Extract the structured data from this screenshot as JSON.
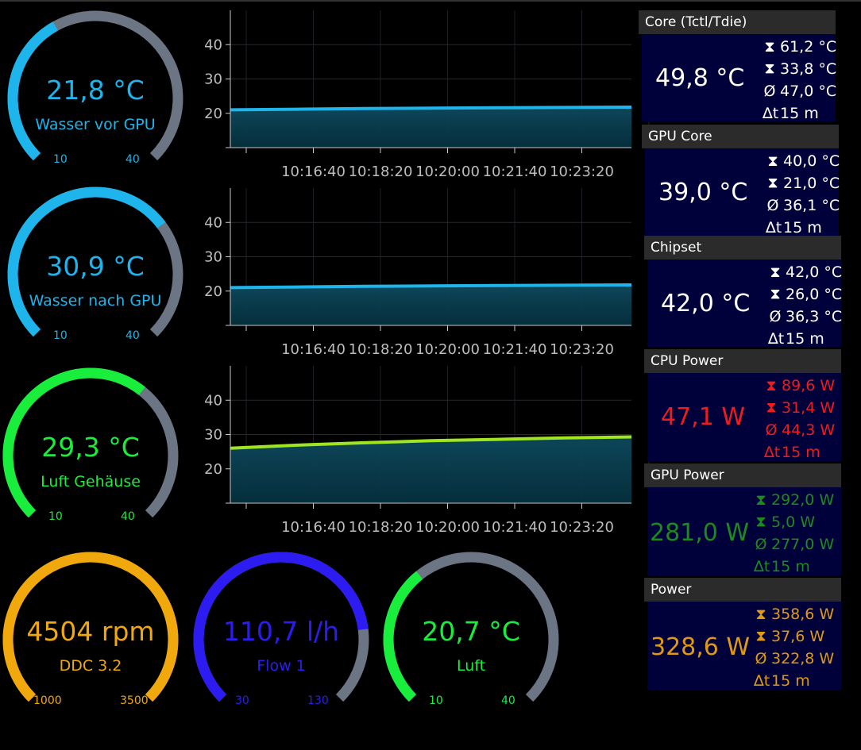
{
  "gauges": [
    {
      "id": "wasser-vor-gpu",
      "value": "21,8 °C",
      "label": "Wasser vor GPU",
      "min": "10",
      "max": "40",
      "fraction": 0.393,
      "color": "#1eb4ec"
    },
    {
      "id": "wasser-nach-gpu",
      "value": "30,9 °C",
      "label": "Wasser nach GPU",
      "min": "10",
      "max": "40",
      "fraction": 0.697,
      "color": "#1eb4ec"
    },
    {
      "id": "luft-gehaeuse",
      "value": "29,3 °C",
      "label": "Luft Gehäuse",
      "min": "10",
      "max": "40",
      "fraction": 0.643,
      "color": "#1aee3c"
    },
    {
      "id": "ddc",
      "value": "4504 rpm",
      "label": "DDC 3.2",
      "min": "1000",
      "max": "3500",
      "fraction": 1.0,
      "color": "#f0a80c"
    },
    {
      "id": "flow",
      "value": "110,7 l/h",
      "label": "Flow 1",
      "min": "30",
      "max": "130",
      "fraction": 0.807,
      "color": "#2d1cf2"
    },
    {
      "id": "luft",
      "value": "20,7 °C",
      "label": "Luft",
      "min": "10",
      "max": "40",
      "fraction": 0.357,
      "color": "#1aee3c"
    }
  ],
  "chart_data": [
    {
      "type": "area",
      "series": [
        {
          "name": "Wasser vor GPU",
          "values": [
            21.0,
            21.2,
            21.4,
            21.5,
            21.6,
            21.7,
            21.8
          ]
        }
      ],
      "x": [
        "10:15:00",
        "10:16:40",
        "10:18:20",
        "10:20:00",
        "10:21:40",
        "10:23:20",
        "10:25:00"
      ],
      "x_tick_labels": [
        "10:16:40",
        "10:18:20",
        "10:20:00",
        "10:21:40",
        "10:23:20"
      ],
      "y_tick_labels": [
        "20",
        "30",
        "40"
      ],
      "ylim": [
        10,
        50
      ],
      "color": "#1eb4ec",
      "grid": true
    },
    {
      "type": "area",
      "series": [
        {
          "name": "Wasser nach GPU",
          "values": [
            21.0,
            21.2,
            21.4,
            21.5,
            21.6,
            21.7,
            21.8
          ]
        }
      ],
      "x": [
        "10:15:00",
        "10:16:40",
        "10:18:20",
        "10:20:00",
        "10:21:40",
        "10:23:20",
        "10:25:00"
      ],
      "x_tick_labels": [
        "10:16:40",
        "10:18:20",
        "10:20:00",
        "10:21:40",
        "10:23:20"
      ],
      "y_tick_labels": [
        "20",
        "30",
        "40"
      ],
      "ylim": [
        10,
        50
      ],
      "color": "#1eb4ec",
      "grid": true
    },
    {
      "type": "area",
      "series": [
        {
          "name": "Luft Gehäuse",
          "values": [
            26.0,
            26.9,
            27.6,
            28.2,
            28.6,
            29.0,
            29.3
          ]
        }
      ],
      "x": [
        "10:15:00",
        "10:16:40",
        "10:18:20",
        "10:20:00",
        "10:21:40",
        "10:23:20",
        "10:25:00"
      ],
      "x_tick_labels": [
        "10:16:40",
        "10:18:20",
        "10:20:00",
        "10:21:40",
        "10:23:20"
      ],
      "y_tick_labels": [
        "20",
        "30",
        "40"
      ],
      "ylim": [
        10,
        50
      ],
      "color": "#9fe620",
      "grid": true
    }
  ],
  "panels": [
    {
      "title": "Core (Tctl/Tdie)",
      "value": "49,8 °C",
      "max": "61,2 °C",
      "min": "33,8 °C",
      "avg": "47,0 °C",
      "dt": "15 m",
      "color": "#ffffff"
    },
    {
      "title": "GPU Core",
      "value": "39,0 °C",
      "max": "40,0 °C",
      "min": "21,0 °C",
      "avg": "36,1 °C",
      "dt": "15 m",
      "color": "#ffffff"
    },
    {
      "title": "Chipset",
      "value": "42,0 °C",
      "max": "42,0 °C",
      "min": "26,0 °C",
      "avg": "36,3 °C",
      "dt": "15 m",
      "color": "#ffffff"
    },
    {
      "title": "CPU Power",
      "value": "47,1 W",
      "max": "89,6 W",
      "min": "31,4 W",
      "avg": "44,3 W",
      "dt": "15 m",
      "color": "#ee1c1c"
    },
    {
      "title": "GPU Power",
      "value": "281,0 W",
      "max": "292,0 W",
      "min": "5,0 W",
      "avg": "277,0 W",
      "dt": "15 m",
      "color": "#1d8a1d"
    },
    {
      "title": "Power",
      "value": "328,6 W",
      "max": "358,6 W",
      "min": "37,6 W",
      "avg": "322,8 W",
      "dt": "15 m",
      "color": "#e09a12"
    }
  ],
  "icons": {
    "max": "max-icon",
    "min": "min-icon",
    "avg": "avg-icon",
    "dt": "delta-t-icon"
  },
  "symbols": {
    "avg": "Ø",
    "dt": "∆t"
  }
}
